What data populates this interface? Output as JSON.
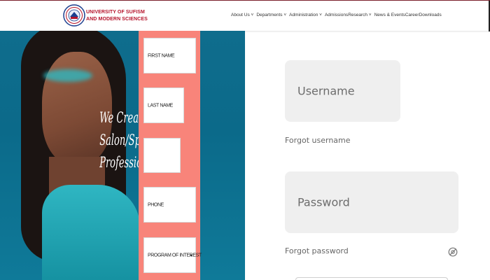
{
  "header": {
    "brand_line1": "UNIVERSITY OF SUFISM",
    "brand_line2": "AND MODERN SCIENCES",
    "nav": [
      {
        "label": "About Us ˅"
      },
      {
        "label": "Departments ˅"
      },
      {
        "label": "Administration ˅"
      },
      {
        "label": "Admissions"
      },
      {
        "label": "Research ˅"
      },
      {
        "label": "News & Events"
      },
      {
        "label": "Career"
      },
      {
        "label": "Downloads"
      }
    ]
  },
  "hero": {
    "headline": [
      "We Create",
      "Salon/Spa",
      "Professionals"
    ]
  },
  "signup_form": {
    "first_name": "FIRST NAME",
    "last_name": "LAST NAME",
    "email": "",
    "phone": "PHONE",
    "program": "PROGRAM OF INTEREST",
    "program_caret": "▾"
  },
  "login": {
    "username_placeholder": "Username",
    "forgot_username": "Forgot username",
    "password_placeholder": "Password",
    "forgot_password": "Forgot password"
  },
  "colors": {
    "brand_red": "#b5132a",
    "hero_teal": "#0f6d8d",
    "form_salmon": "#f8847a",
    "input_gray": "#efefef"
  },
  "icons": [
    "university-seal-icon",
    "eye-slash-icon"
  ]
}
